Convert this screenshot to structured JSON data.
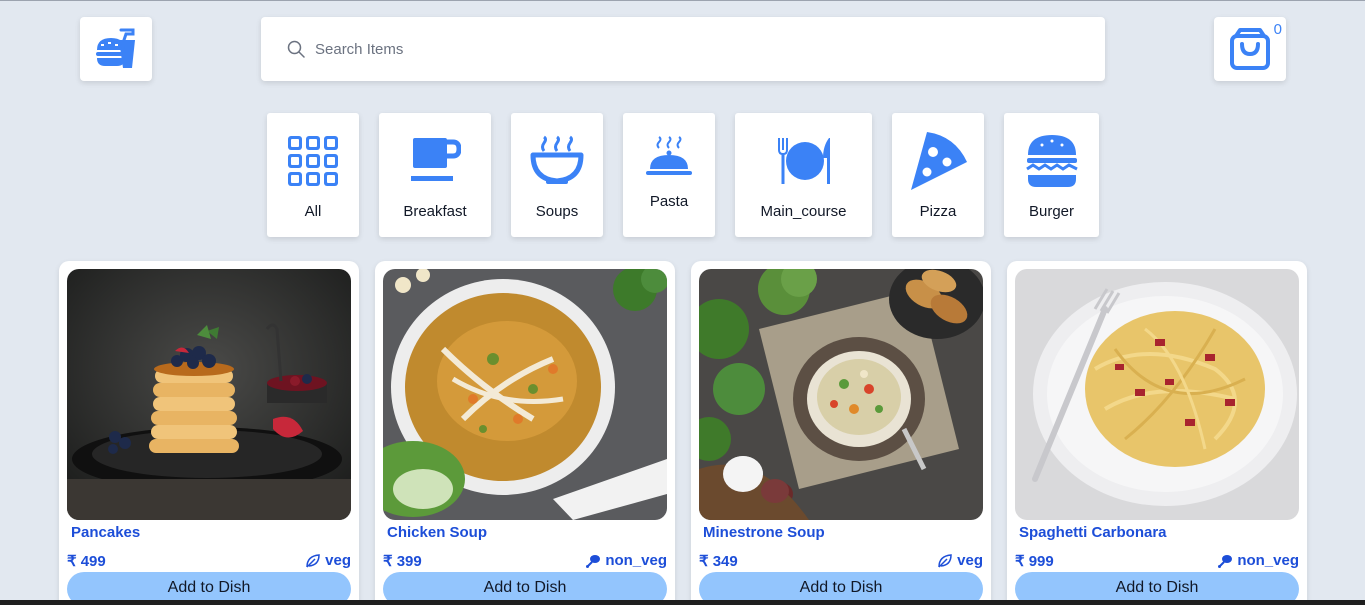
{
  "header": {
    "search": {
      "placeholder": "Search Items",
      "value": ""
    },
    "cart": {
      "count": "0"
    }
  },
  "colors": {
    "accent": "#3b82f6",
    "link": "#1d4ed8",
    "button": "#93c5fd",
    "background": "#e2e8f0"
  },
  "categories": [
    {
      "label": "All",
      "icon": "grid-icon"
    },
    {
      "label": "Breakfast",
      "icon": "coffee-cup-icon"
    },
    {
      "label": "Soups",
      "icon": "soup-bowl-icon"
    },
    {
      "label": "Pasta",
      "icon": "serving-cloche-icon"
    },
    {
      "label": "Main_course",
      "icon": "plate-fork-knife-icon"
    },
    {
      "label": "Pizza",
      "icon": "pizza-slice-icon"
    },
    {
      "label": "Burger",
      "icon": "burger-icon"
    }
  ],
  "items": [
    {
      "name": "Pancakes",
      "price": "₹ 499",
      "type": "veg",
      "type_icon": "leaf-icon",
      "button": "Add to Dish"
    },
    {
      "name": "Chicken Soup",
      "price": "₹ 399",
      "type": "non_veg",
      "type_icon": "drumstick-icon",
      "button": "Add to Dish"
    },
    {
      "name": "Minestrone Soup",
      "price": "₹ 349",
      "type": "veg",
      "type_icon": "leaf-icon",
      "button": "Add to Dish"
    },
    {
      "name": "Spaghetti Carbonara",
      "price": "₹ 999",
      "type": "non_veg",
      "type_icon": "drumstick-icon",
      "button": "Add to Dish"
    }
  ]
}
